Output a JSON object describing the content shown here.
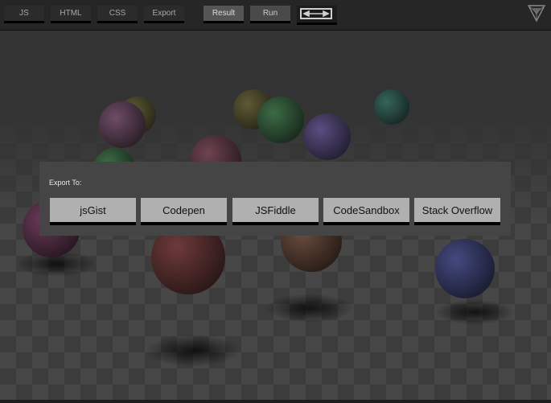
{
  "toolbar": {
    "js_label": "JS",
    "html_label": "HTML",
    "css_label": "CSS",
    "export_label": "Export",
    "result_label": "Result",
    "run_label": "Run",
    "toggle_icon": "fullscreen-toggle-icon",
    "logo_icon": "triangle-logo-icon"
  },
  "export_dialog": {
    "title": "Export To:",
    "buttons": {
      "jsgist": "jsGist",
      "codepen": "Codepen",
      "jsfiddle": "JSFiddle",
      "codesandbox": "CodeSandbox",
      "stackoverflow": "Stack Overflow"
    }
  },
  "colors": {
    "toolbar_bg": "#262626",
    "dialog_bg": "#454545",
    "button_bg": "#b0b0b0"
  }
}
